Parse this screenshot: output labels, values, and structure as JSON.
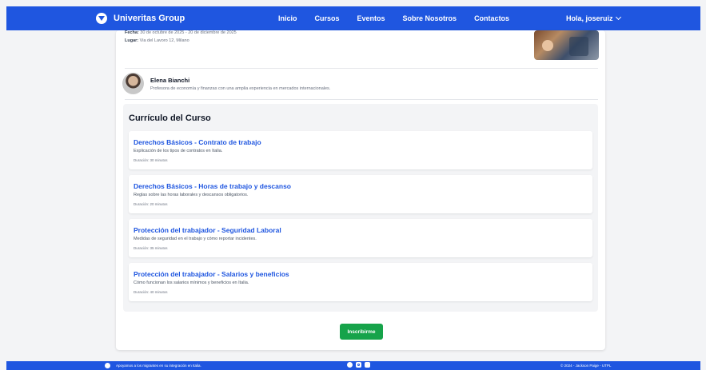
{
  "navbar": {
    "brand": "Univeritas Group",
    "links": [
      "Inicio",
      "Cursos",
      "Eventos",
      "Sobre Nosotros",
      "Contactos"
    ],
    "user_greeting": "Hola, joseruiz"
  },
  "course": {
    "date_label": "Fecha:",
    "date_value": "30 de octubre de 2025 - 20 de diciembre de 2025",
    "location_label": "Lugar:",
    "location_value": "Via del Lavoro 12, Milano"
  },
  "instructor": {
    "name": "Elena Bianchi",
    "bio": "Profesora de economía y finanzas con una amplia experiencia en mercados internacionales."
  },
  "curriculum": {
    "title": "Currículo del Curso",
    "lessons": [
      {
        "title": "Derechos Básicos - Contrato de trabajo",
        "description": "Explicación de los tipos de contratos en Italia.",
        "duration": "Duración: 30 minutos"
      },
      {
        "title": "Derechos Básicos - Horas de trabajo y descanso",
        "description": "Reglas sobre las horas laborales y descansos obligatorios.",
        "duration": "Duración: 20 minutos"
      },
      {
        "title": "Protección del trabajador - Seguridad Laboral",
        "description": "Medidas de seguridad en el trabajo y cómo reportar incidentes.",
        "duration": "Duración: 35 minutos"
      },
      {
        "title": "Protección del trabajador - Salarios y beneficios",
        "description": "Cómo funcionan los salarios mínimos y beneficios en Italia.",
        "duration": "Duración: 40 minutos"
      }
    ]
  },
  "enroll_button": "Inscribirme",
  "footer": {
    "tagline": "Apoyamos a los migrantes en su integración en Italia.",
    "social_icons": [
      "facebook-icon",
      "instagram-icon",
      "linkedin-icon"
    ],
    "copyright": "© 2024 - Jackson Paige - UTPL"
  },
  "colors": {
    "primary": "#1f56e0",
    "success": "#16a34a",
    "background": "#f3f4f6"
  }
}
